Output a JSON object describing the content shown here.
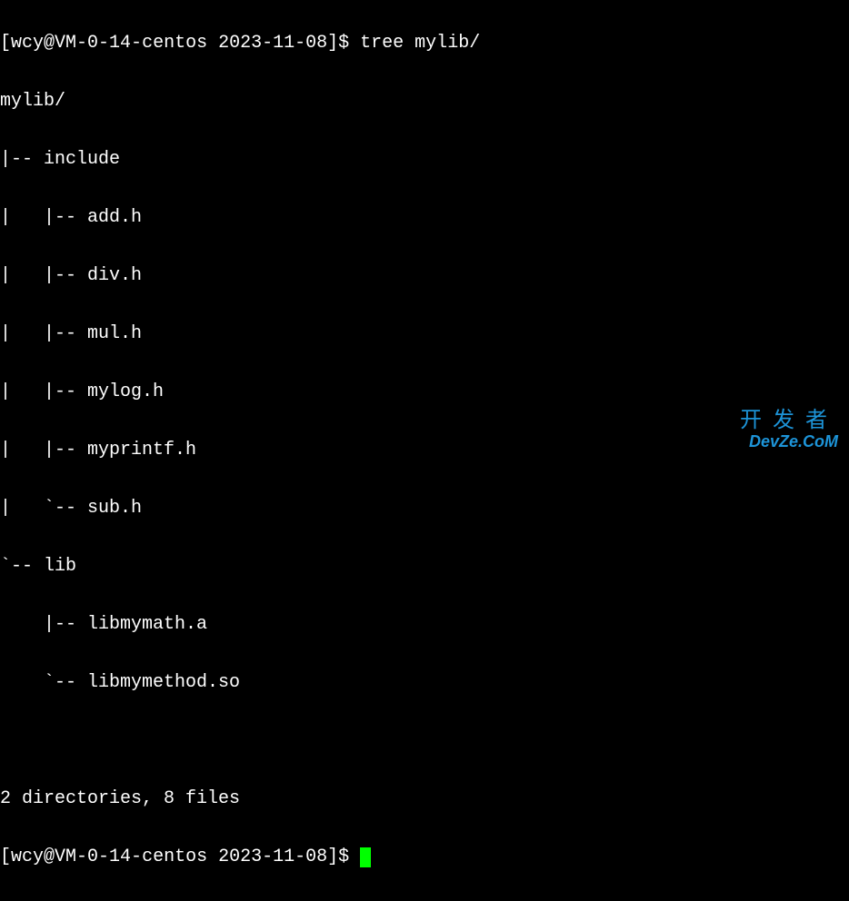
{
  "prompt1": {
    "user": "wcy",
    "host": "VM-0-14-centos",
    "dir": "2023-11-08",
    "command": "tree mylib/"
  },
  "tree": {
    "root": "mylib/",
    "lines": [
      "|-- include",
      "|   |-- add.h",
      "|   |-- div.h",
      "|   |-- mul.h",
      "|   |-- mylog.h",
      "|   |-- myprintf.h",
      "|   `-- sub.h",
      "`-- lib",
      "    |-- libmymath.a",
      "    `-- libmymethod.so"
    ],
    "summary": "2 directories, 8 files"
  },
  "prompt2": {
    "user": "wcy",
    "host": "VM-0-14-centos",
    "dir": "2023-11-08"
  },
  "watermark": {
    "cn": "开发者",
    "en": "DevZe.CoM"
  }
}
